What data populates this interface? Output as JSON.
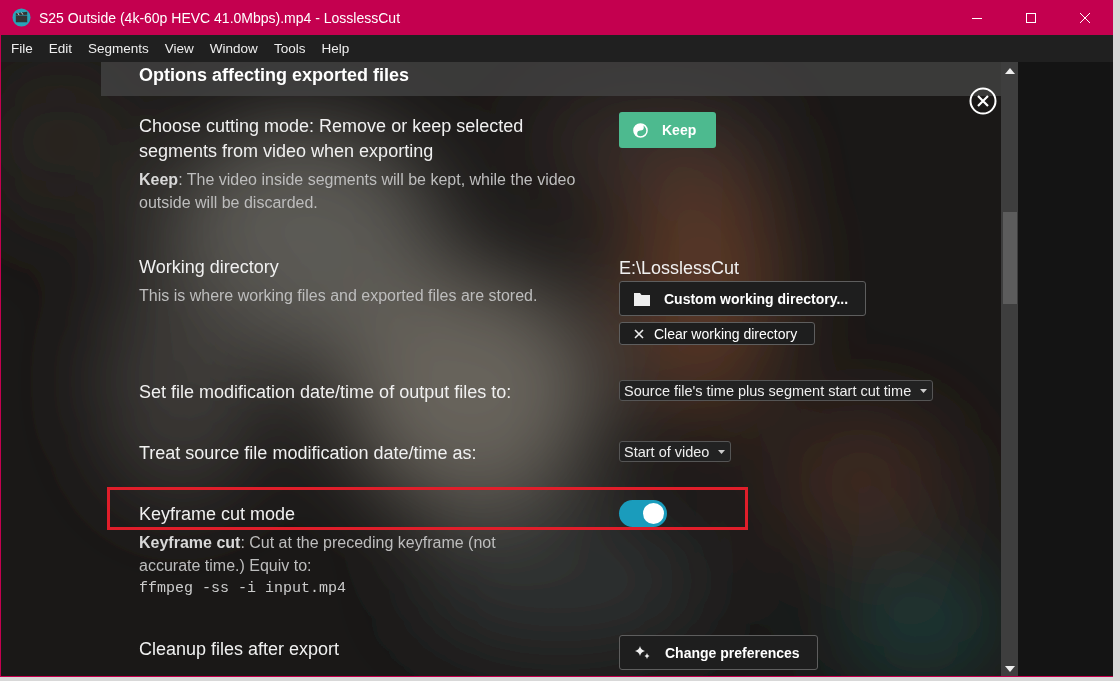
{
  "window": {
    "title": "S25 Outside (4k-60p HEVC 41.0Mbps).mp4 - LosslessCut"
  },
  "menu": [
    "File",
    "Edit",
    "Segments",
    "View",
    "Window",
    "Tools",
    "Help"
  ],
  "settings": {
    "header": "Options affecting exported files",
    "rows": [
      {
        "kind": "button",
        "label": "Choose cutting mode: Remove or keep selected segments from video when exporting",
        "description": "**Keep**: The video inside segments will be kept, while the video outside will be discarded.",
        "button": "Keep",
        "highlighted": false
      },
      {
        "kind": "directory",
        "label": "Working directory",
        "description": "This is where working files and exported files are stored.",
        "path": "E:\\LosslessCut",
        "buttons": [
          "Custom working directory...",
          "Clear working directory"
        ],
        "highlighted": false
      },
      {
        "kind": "select",
        "label": "Set file modification date/time of output files to:",
        "value": "Source file's time plus segment start cut time",
        "highlighted": false
      },
      {
        "kind": "select",
        "label": "Treat source file modification date/time as:",
        "value": "Start of video",
        "highlighted": false
      },
      {
        "kind": "toggle",
        "label": "Keyframe cut mode",
        "description": "**Keyframe cut**: Cut at the preceding keyframe (not accurate time.) Equiv to:",
        "code": "ffmpeg -ss -i input.mp4",
        "on": true,
        "highlighted": true
      },
      {
        "kind": "outline-button",
        "label": "Cleanup files after export",
        "button": "Change preferences",
        "highlighted": false
      }
    ]
  }
}
